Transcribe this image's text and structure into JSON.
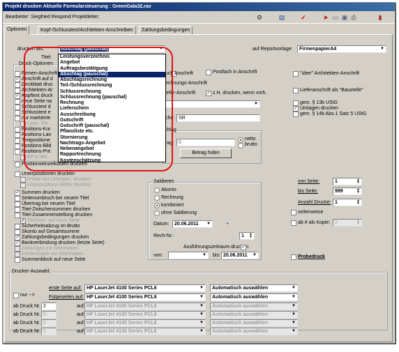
{
  "window": {
    "title": "Projekt drucken Aktuelle Formularsteuerung : GreenGala32.rav"
  },
  "toolbar": {
    "bearbeiter": "Bearbeiter: Siegfried Respond Projektleiter:"
  },
  "tabs": [
    "Optionen",
    "Kopf-/Schlusstext/Architekten-Anschreiben",
    "Zahlungsbedingungen"
  ],
  "drucken_als": {
    "label": "drucken als:",
    "value": "Abschlag (pauschal)",
    "options": [
      "Leistungsverzeichnis",
      "Angebot",
      "Auftragsbestätigung",
      "Abschlag (pauschal)",
      "Abschlagsrechnung",
      "Teil-/Schlussrechnung",
      "Schlussrechnung",
      "Schlussrechnung (pauschal)",
      "Rechnung",
      "Lieferschein",
      "Ausschreibung",
      "Gutschrift",
      "Gutschrift (pauschal)",
      "Pflanzliste etc.",
      "Stornierung",
      "Nachtrags-Angebot",
      "Nebenangebot",
      "Rapportrechnung",
      "Kostenschätzung"
    ],
    "selected_index": 3
  },
  "titel_label": "Titel:",
  "reportvorlage": {
    "label": "auf Reportvorlage:",
    "value": "FirmenpapierA4"
  },
  "druck_optionen": {
    "caption": "Druck-Optionen",
    "items": [
      "Firmen-Anschrift",
      "Anschrift auf d",
      "Deckblatt druc",
      "Architekten-Ar",
      "Kopftext druck",
      "neue Seite na",
      "Schlusstext d",
      "Schlusstext e",
      "nur markierte",
      "Lose: Tite",
      "Positions-Kur",
      "Positions-Lan",
      "Textpositione",
      "Positions-Bild",
      "Positions-Pre",
      "EP in Wo",
      "Positionseinzelkosten drucken"
    ]
  },
  "anschrift_opts": {
    "auch_label": "auch Anschrift",
    "postfach": "Postfach in Anschrift",
    "rechnungs": "echnungs-Anschrift",
    "liefer": "iefer-Anschrift",
    "zh": "z.H. drucken, wenn vorh."
  },
  "architekten": {
    "ueber": "\"über\" Architekten-Anschrift",
    "liefer_baustelle": "Lieferanschrift als \"Baustelle\""
  },
  "ust": {
    "items": [
      "gem. § 13b UStG",
      "Umlagen drucken",
      "gem. § 14b Abs.1 Satz 5 UStG"
    ]
  },
  "suche": {
    "label": "che:",
    "value": "SR"
  },
  "abschlag": {
    "caption": "chlag",
    "label": "rag:",
    "value": "0",
    "netto": "netto",
    "brutto": "brutto",
    "button": "Betrag holen"
  },
  "unterpositionen": {
    "label": "Unterpositionen drucken",
    "preise": "Preise der Unterpos. drucken",
    "bilder": "Unterpositions-Bilder drucken"
  },
  "summen": {
    "items": [
      "Summen drucken",
      "Seitenumbruch bei neuem Titel",
      "Übertrag bei neuem Titel",
      "Titel-Zwischensummen drucken",
      "Titel-Zusammenstellung drucken",
      "Titelsum. auf neue Seite",
      "Sicherheitsabzug im Brutto",
      "Skonto auf Gesamtsumme",
      "Zahlungsbedingungen drucken",
      "Bankverbindung drucken  (letzte Seite)",
      "Zahlungen zur Information",
      "Forderungen zur Information",
      "Summenblock auf neue Seite"
    ]
  },
  "saldieren": {
    "caption": "Saldieren",
    "options": [
      "Akonto",
      "Rechnung",
      "kombiniert",
      "ohne Saldierung"
    ],
    "selected": 2,
    "datum_label": "Datum:",
    "datum": "20.06.2011",
    "rechnr_label": "Rech-Nr.:",
    "rechnr": "1",
    "ausfuehrung": "Ausführungszeitraum drucken",
    "von_label": "von:",
    "bis_label": "bis:",
    "bis": "20.06.2011"
  },
  "seiten": {
    "von_label": "von Seite:",
    "von": "1",
    "bis_label": "bis Seite:",
    "bis": "999",
    "anzahl_label": "Anzahl Drucke:",
    "anzahl": "1",
    "seitenweise": "seitenweise",
    "ab_kopie": "ab # als Kopie:",
    "ab_kopie_val": "2"
  },
  "probedruck": "Probedruck",
  "drucker": {
    "caption": "Drucker-Auswahl:",
    "nur": "nur -->",
    "erste_label": "erste Seite auf:",
    "folge_label": "Folgeseiten auf:",
    "ab_label": "ab Druck Nr.",
    "auf_label": "auf:",
    "printer": "HP LaserJet 4100 Series PCL6",
    "auto": "Automatisch auswählen",
    "ab_values": [
      "2",
      "0",
      "0",
      "0"
    ]
  }
}
